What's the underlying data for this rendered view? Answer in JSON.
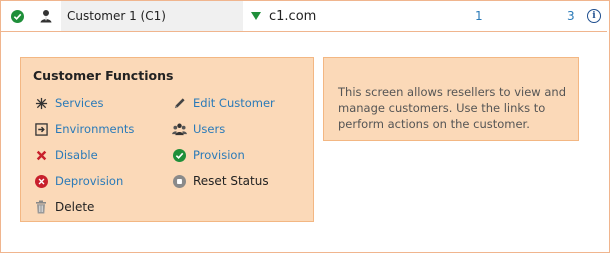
{
  "header": {
    "customer_name": "Customer 1 (C1)",
    "domain": "c1.com",
    "count_a": "1",
    "count_b": "3"
  },
  "functions": {
    "title": "Customer Functions",
    "left": [
      {
        "label": "Services",
        "icon": "snowflake-icon"
      },
      {
        "label": "Environments",
        "icon": "environment-icon"
      },
      {
        "label": "Disable",
        "icon": "x-icon"
      },
      {
        "label": "Deprovision",
        "icon": "deprovision-icon"
      },
      {
        "label": "Delete",
        "icon": "trash-icon"
      }
    ],
    "right": [
      {
        "label": "Edit Customer",
        "icon": "pencil-icon"
      },
      {
        "label": "Users",
        "icon": "users-icon"
      },
      {
        "label": "Provision",
        "icon": "check-icon"
      },
      {
        "label": "Reset Status",
        "icon": "reset-icon"
      }
    ]
  },
  "help": {
    "text": "This screen allows resellers to view and manage customers. Use the links to perform actions on the customer."
  },
  "colors": {
    "panel_bg": "#fbd9b8",
    "panel_border": "#f3b783",
    "link": "#2a7ab8",
    "ok_green": "#1f8f3a",
    "danger_red": "#c8202c"
  }
}
